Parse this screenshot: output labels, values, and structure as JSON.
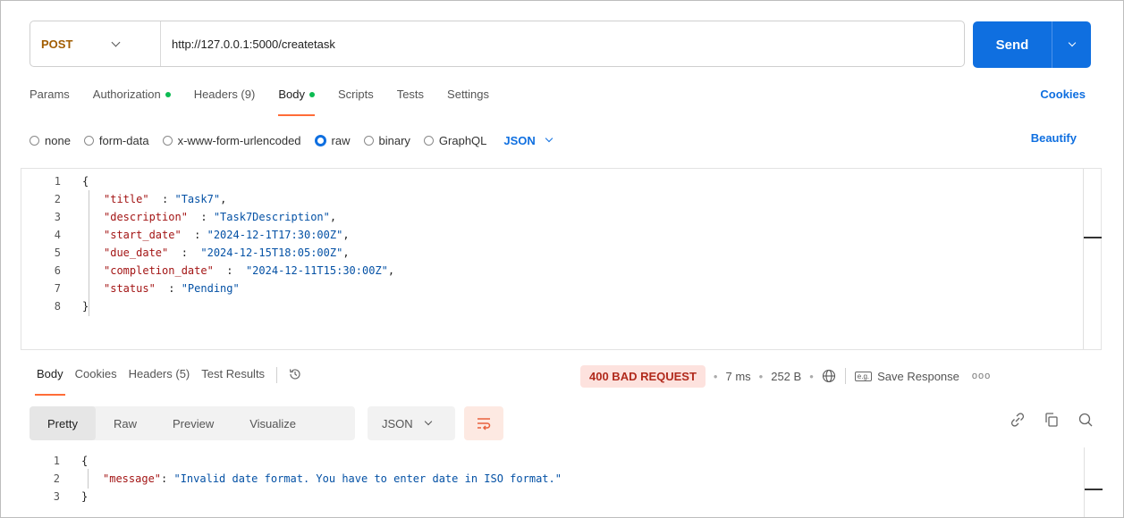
{
  "request": {
    "method": "POST",
    "url": "http://127.0.0.1:5000/createtask",
    "send_label": "Send"
  },
  "request_tabs": [
    {
      "label": "Params",
      "dot": false,
      "active": false
    },
    {
      "label": "Authorization",
      "dot": true,
      "active": false
    },
    {
      "label": "Headers (9)",
      "dot": false,
      "active": false
    },
    {
      "label": "Body",
      "dot": true,
      "active": true
    },
    {
      "label": "Scripts",
      "dot": false,
      "active": false
    },
    {
      "label": "Tests",
      "dot": false,
      "active": false
    },
    {
      "label": "Settings",
      "dot": false,
      "active": false
    }
  ],
  "cookies_link": "Cookies",
  "body_types": [
    {
      "label": "none",
      "checked": false
    },
    {
      "label": "form-data",
      "checked": false
    },
    {
      "label": "x-www-form-urlencoded",
      "checked": false
    },
    {
      "label": "raw",
      "checked": true
    },
    {
      "label": "binary",
      "checked": false
    },
    {
      "label": "GraphQL",
      "checked": false
    }
  ],
  "body_language": "JSON",
  "beautify_label": "Beautify",
  "request_body_lines": [
    {
      "n": "1",
      "text": "{"
    },
    {
      "n": "2",
      "key": "\"title\"",
      "sep": "  : ",
      "val": "\"Task7\"",
      "end": ","
    },
    {
      "n": "3",
      "key": "\"description\"",
      "sep": "  : ",
      "val": "\"Task7Description\"",
      "end": ","
    },
    {
      "n": "4",
      "key": "\"start_date\"",
      "sep": "  : ",
      "val": "\"2024-12-1T17:30:00Z\"",
      "end": ","
    },
    {
      "n": "5",
      "key": "\"due_date\"",
      "sep": "  :  ",
      "val": "\"2024-12-15T18:05:00Z\"",
      "end": ","
    },
    {
      "n": "6",
      "key": "\"completion_date\"",
      "sep": "  :  ",
      "val": "\"2024-12-11T15:30:00Z\"",
      "end": ","
    },
    {
      "n": "7",
      "key": "\"status\"",
      "sep": "  : ",
      "val": "\"Pending\"",
      "end": ""
    },
    {
      "n": "8",
      "text": "}"
    }
  ],
  "response_tabs": [
    {
      "label": "Body",
      "active": true
    },
    {
      "label": "Cookies",
      "active": false
    },
    {
      "label": "Headers (5)",
      "active": false
    },
    {
      "label": "Test Results",
      "active": false
    }
  ],
  "response_status": {
    "code": "400 BAD REQUEST",
    "time": "7 ms",
    "size": "252 B",
    "save_label": "Save Response",
    "more": "ooo",
    "save_icon_text": "e.g.",
    "badge_color": "#fde2de"
  },
  "view_tabs": [
    {
      "label": "Pretty",
      "active": true
    },
    {
      "label": "Raw",
      "active": false
    },
    {
      "label": "Preview",
      "active": false
    },
    {
      "label": "Visualize",
      "active": false
    }
  ],
  "response_format": "JSON",
  "response_body_lines": [
    {
      "n": "1",
      "text": "{"
    },
    {
      "n": "2",
      "key": "\"message\"",
      "sep": ": ",
      "val": "\"Invalid date format. You have to enter date in ISO format.\"",
      "end": ""
    },
    {
      "n": "3",
      "text": "}"
    }
  ],
  "colors": {
    "accent": "#0f6fe0",
    "method": "#a15c00",
    "tab_underline": "#ff6c37",
    "status_dot": "#0cbb52",
    "error_text": "#b12a1c"
  }
}
